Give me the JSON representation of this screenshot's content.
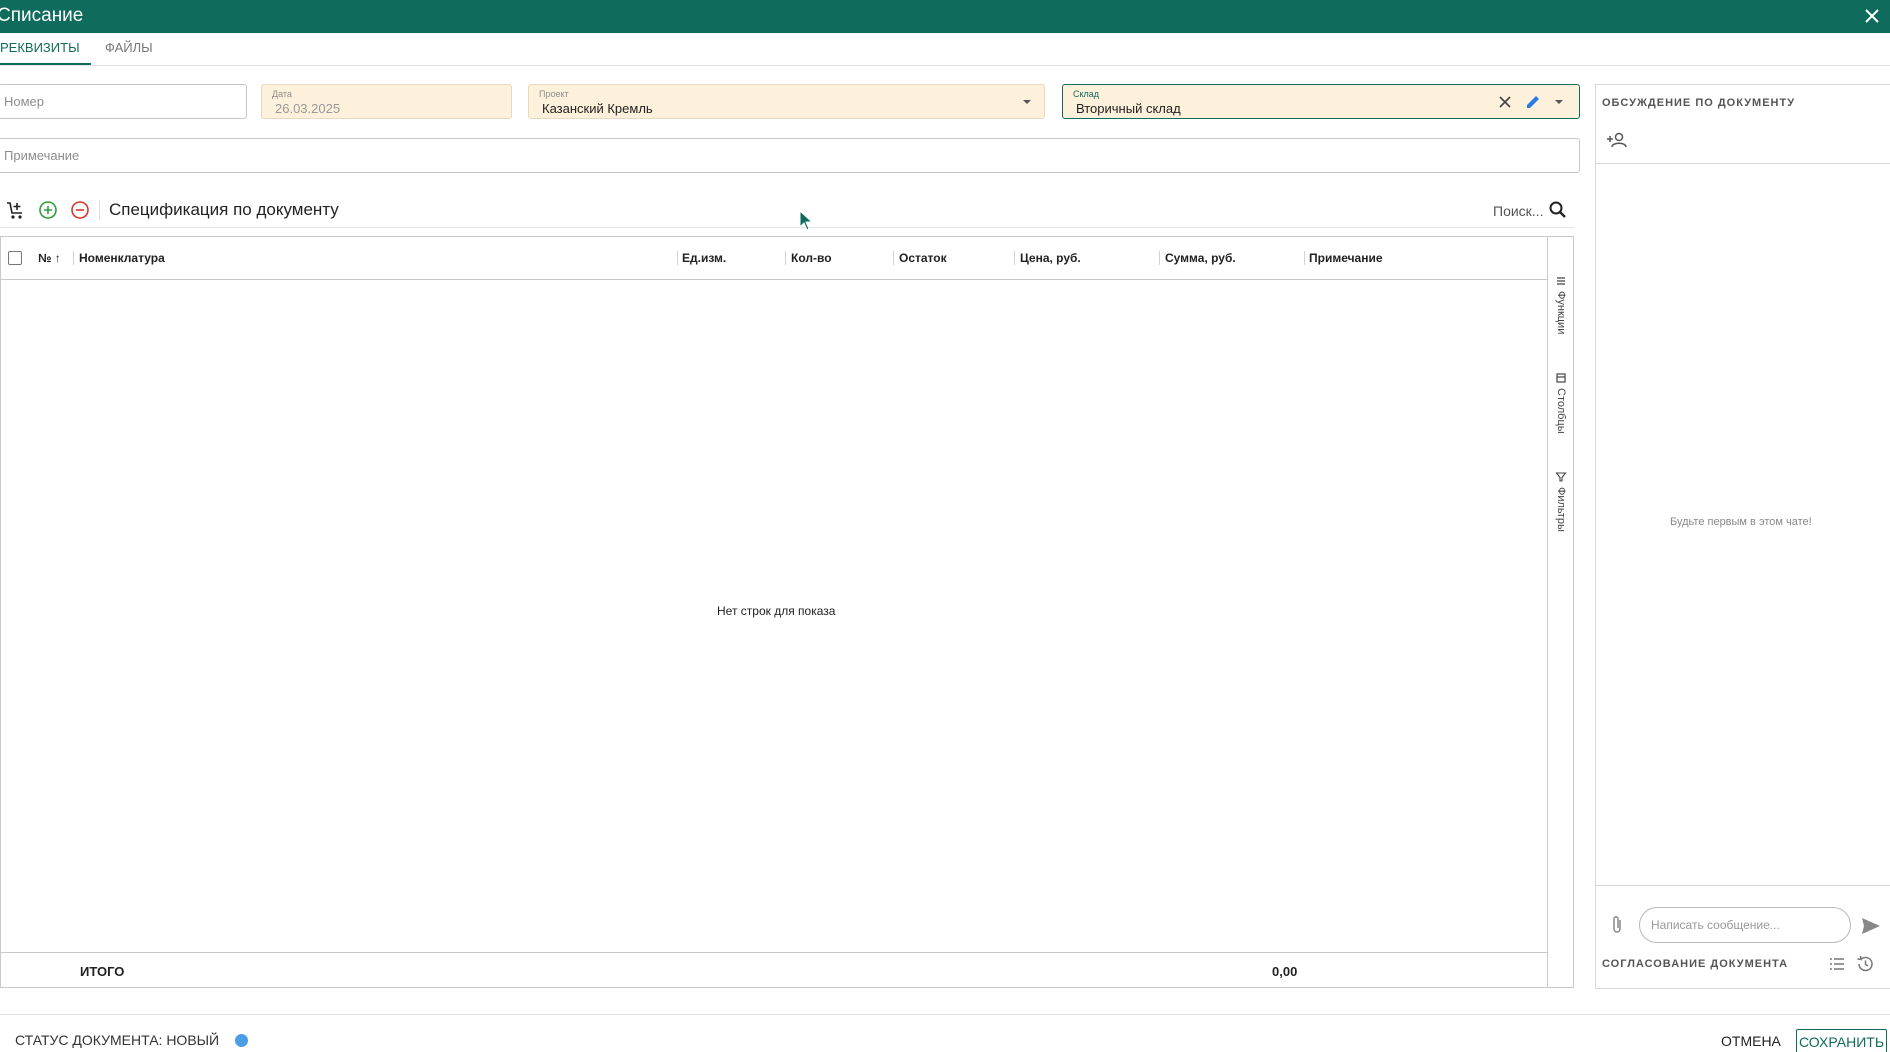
{
  "window": {
    "title": "Списание",
    "close_icon": "close-icon"
  },
  "tabs": [
    {
      "label": "РЕКВИЗИТЫ",
      "active": true
    },
    {
      "label": "ФАЙЛЫ",
      "active": false
    }
  ],
  "form": {
    "number": {
      "placeholder": "Номер"
    },
    "date": {
      "label": "Дата",
      "value": "26.03.2025"
    },
    "project": {
      "label": "Проект",
      "value": "Казанский Кремль"
    },
    "warehouse": {
      "label": "Склад",
      "value": "Вторичный склад"
    },
    "note": {
      "placeholder": "Примечание"
    }
  },
  "spec": {
    "title": "Спецификация по документу",
    "search_placeholder": "Поиск...",
    "columns": [
      "№",
      "Номенклатура",
      "Ед.изм.",
      "Кол-во",
      "Остаток",
      "Цена, руб.",
      "Сумма, руб.",
      "Примечание"
    ],
    "empty_text": "Нет строк для показа",
    "total_label": "ИТОГО",
    "total_sum": "0,00",
    "side_panel": [
      "Функции",
      "Столбцы",
      "Фильтры"
    ]
  },
  "chat": {
    "header": "ОБСУЖДЕНИЕ ПО ДОКУМЕНТУ",
    "empty_text": "Будьте первым в этом чате!",
    "message_placeholder": "Написать сообщение...",
    "approval_header": "СОГЛАСОВАНИЕ ДОКУМЕНТА"
  },
  "footer": {
    "status": "СТАТУС ДОКУМЕНТА: НОВЫЙ",
    "status_color": "#4a9ee8",
    "cancel": "ОТМЕНА",
    "save": "СОХРАНИТЬ"
  },
  "colors": {
    "accent": "#0f6b5b",
    "readonly_bg": "#fdf1dc"
  }
}
